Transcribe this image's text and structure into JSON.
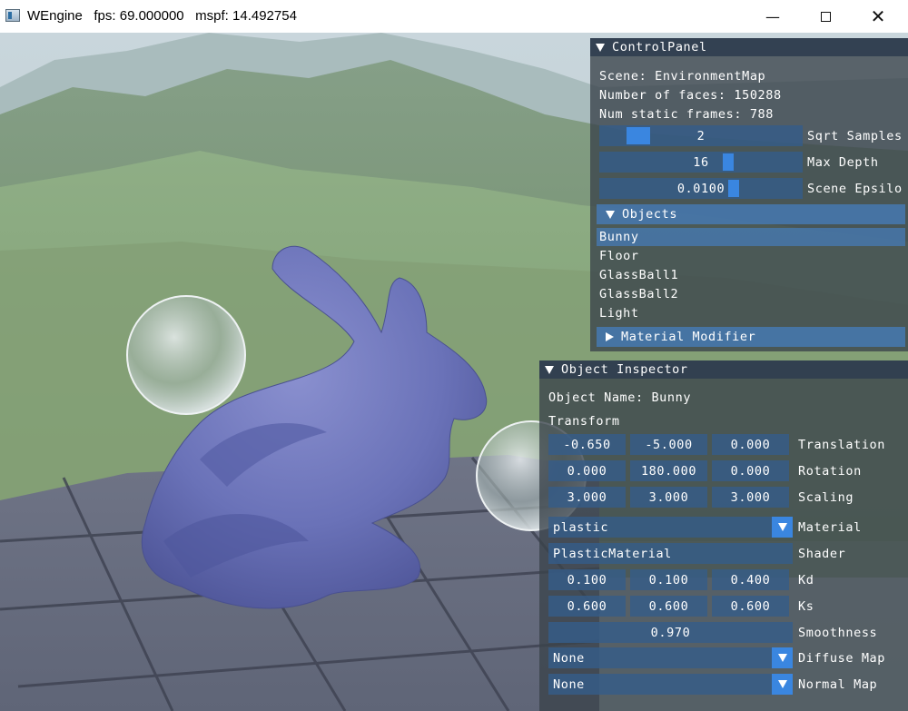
{
  "window": {
    "app_name": "WEngine",
    "fps_text": "fps: 69.000000",
    "mspf_text": "mspf: 14.492754",
    "minimize_glyph": "—",
    "close_glyph": "✕"
  },
  "control_panel": {
    "title": "ControlPanel",
    "scene_line": "Scene: EnvironmentMap",
    "faces_line": "Number of faces: 150288",
    "frames_line": "Num static frames: 788",
    "sqrt_samples": {
      "value": "2",
      "label": "Sqrt Samples"
    },
    "max_depth": {
      "value": "16",
      "label": "Max Depth"
    },
    "scene_epsilon": {
      "value": "0.0100",
      "label": "Scene Epsilo"
    },
    "objects_header": "Objects",
    "objects": [
      "Bunny",
      "Floor",
      "GlassBall1",
      "GlassBall2",
      "Light"
    ],
    "selected_object": "Bunny",
    "material_modifier_header": "Material Modifier"
  },
  "inspector": {
    "title": "Object Inspector",
    "object_name_line": "Object Name: Bunny",
    "transform_label": "Transform",
    "translation": {
      "values": [
        "-0.650",
        "-5.000",
        "0.000"
      ],
      "label": "Translation"
    },
    "rotation": {
      "values": [
        "0.000",
        "180.000",
        "0.000"
      ],
      "label": "Rotation"
    },
    "scaling": {
      "values": [
        "3.000",
        "3.000",
        "3.000"
      ],
      "label": "Scaling"
    },
    "material": {
      "value": "plastic",
      "label": "Material"
    },
    "shader": {
      "value": "PlasticMaterial",
      "label": "Shader"
    },
    "kd": {
      "values": [
        "0.100",
        "0.100",
        "0.400"
      ],
      "label": "Kd"
    },
    "ks": {
      "values": [
        "0.600",
        "0.600",
        "0.600"
      ],
      "label": "Ks"
    },
    "smoothness": {
      "value": "0.970",
      "label": "Smoothness"
    },
    "diffuse_map": {
      "value": "None",
      "label": "Diffuse Map"
    },
    "normal_map": {
      "value": "None",
      "label": "Normal Map"
    }
  },
  "colors": {
    "panel_bg": "#3a424a",
    "field_bg": "#345c8a",
    "accent": "#3a86e0",
    "bunny": "#6a73b8"
  }
}
